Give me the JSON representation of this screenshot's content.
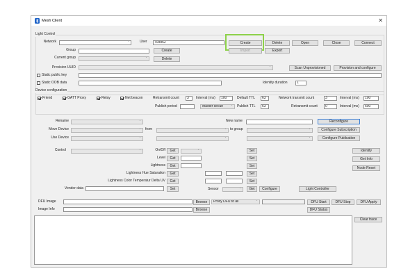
{
  "window": {
    "title": "Mesh Client"
  },
  "light_control": {
    "group_label": "Light Control",
    "network_label": "Network",
    "network_value": "",
    "user_label": "User",
    "user_value": "709862",
    "create_network": "Create",
    "delete_network": "Delete",
    "open": "Open",
    "close": "Close",
    "connect": "Connect",
    "group_label2": "Group",
    "group_value": "",
    "create_group": "Create",
    "import": "Import",
    "export": "Export",
    "current_group_label": "Current group",
    "delete_group": "Delete",
    "provision_uuid_label": "Provision UUID",
    "scan_unprovisioned": "Scan Unprovisioned",
    "provision_configure": "Provision and configure",
    "static_public_key": "Static public key",
    "static_oob_label": "Static OOB data",
    "identity_duration_label": "Identity duration",
    "identity_duration_value": "1"
  },
  "device_config": {
    "label": "Device configuration",
    "friend": "Friend",
    "gatt_proxy": "GATT Proxy",
    "relay": "Relay",
    "net_beacon": "Net beacon",
    "retransmit_count_label": "Retransmit count",
    "retransmit_count_value": "3",
    "interval_label": "Interval (ms)",
    "interval_value": "100",
    "default_ttl_label": "Default TTL",
    "default_ttl_value": "63",
    "net_transmit_label": "Network transmit count",
    "net_transmit_value": "3",
    "net_interval_label": "Interval (ms)",
    "net_interval_value": "100",
    "publish_period_label": "Publish period",
    "publish_period_value": "",
    "master_security": "Master securi",
    "publish_ttl_label": "Publish TTL",
    "publish_ttl_value": "63",
    "retransmit_count2_label": "Retransmit count",
    "retransmit_count2_value": "0",
    "interval2_label": "Interval (ms)",
    "interval2_value": "500"
  },
  "device_ops": {
    "rename_label": "Rename",
    "new_name_label": "New name",
    "new_name_value": "",
    "reconfigure": "Reconfigure",
    "move_device_label": "Move Device",
    "from_label": "from",
    "to_group_label": "to group",
    "configure_subscription": "Configure Subscription",
    "use_device_label": "Use Device",
    "configure_publication": "Configure Publication"
  },
  "control": {
    "control_label": "Control",
    "onoff_label": "On/Off",
    "get": "Get",
    "set": "Set",
    "level_label": "Level",
    "lightness_label": "Lightness",
    "hue_sat_label": "Lightness Hue Saturation",
    "ctl_label": "Lightness Color Temperatur Delta UV",
    "vendor_label": "Vendor data",
    "sensor_label": "Sensor",
    "configure": "Configure",
    "light_controller": "Light Controller",
    "identify": "Identify",
    "get_info": "Get Info",
    "node_reset": "Node Reset"
  },
  "dfu": {
    "image_label": "DFU Image",
    "browse": "Browse",
    "proxy_option": "Proxy DFU to all",
    "dfu_start": "DFU Start",
    "dfu_stop": "DFU Stop",
    "dfu_apply": "DFU Apply",
    "image_info_label": "Image Info",
    "dfu_status": "DFU Status"
  },
  "trace": {
    "clear": "Clear trace"
  },
  "colors": {
    "highlight": "#8dd14a",
    "focus_blue": "#3b7fd6"
  }
}
